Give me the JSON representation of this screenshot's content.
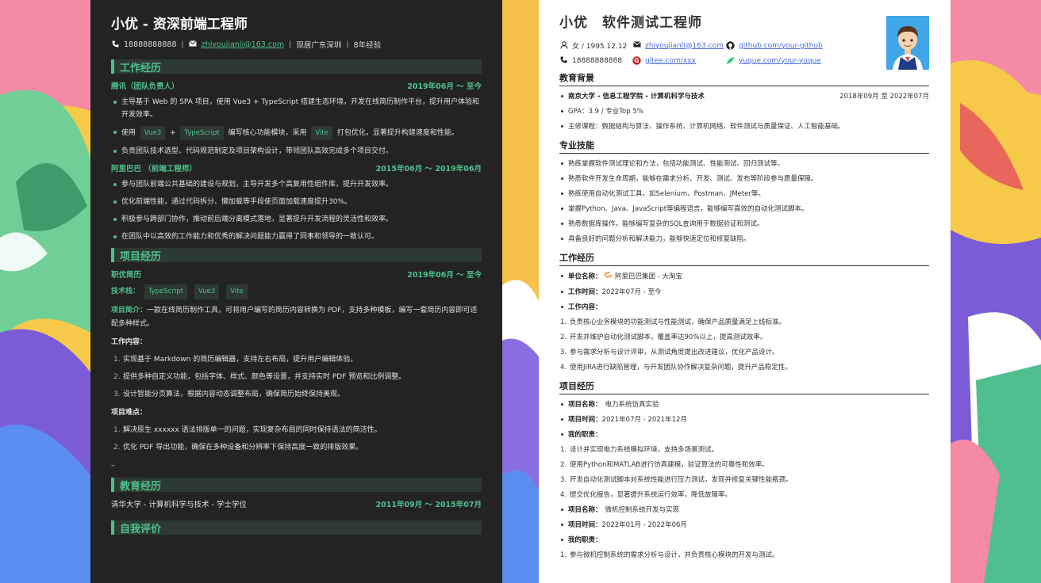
{
  "colors": {
    "accent": "#4fc08d",
    "dark_bg": "#232323",
    "link_blue": "#4a6bd8"
  },
  "dark_resume": {
    "name": "小优 - 资深前端工程师",
    "phone": "18888888888",
    "email": "zhiyoujianli@163.com",
    "location": "现居广东深圳",
    "experience_years": "8年经验",
    "sections": {
      "work": "工作经历",
      "projects": "项目经历",
      "education": "教育经历",
      "self_eval": "自我评价"
    },
    "jobs": [
      {
        "company": "腾讯（团队负责人）",
        "date": "2019年06月 ～ 至今",
        "items": [
          "主导基于 Web 的 SPA 项目，使用 Vue3 + TypeScript 搭建生态环境，开发在线简历制作平台，提升用户体验和开发效率。",
          "负责团队技术选型、代码规范制定及项目架构设计，带领团队高效完成多个项目交付。"
        ],
        "rich_item": {
          "pre": "使用",
          "tag1": "Vue3",
          "plus": "+",
          "tag2": "TypeScript",
          "mid": "编写核心功能模块，采用",
          "tag3": "Vite",
          "post": "打包优化，显著提升构建速度和性能。"
        }
      },
      {
        "company": "阿里巴巴 （前端工程师）",
        "date": "2015年06月 ～ 2019年06月",
        "items": [
          "参与团队前端公共基础的建设与规划，主导开发多个高复用性组件库，提升开发效率。",
          "优化前端性能，通过代码拆分、懒加载等手段使页面加载速度提升30%。",
          "积极参与跨部门协作，推动前后端分离模式落地，显著提升开发流程的灵活性和效率。",
          "在团队中以高效的工作能力和优秀的解决问题能力赢得了同事和领导的一致认可。"
        ]
      }
    ],
    "project": {
      "name": "职优简历",
      "date": "2019年06月 ～ 至今",
      "stack_label": "技术栈：",
      "stack": [
        "TypeScript",
        "Vue3",
        "Vite"
      ],
      "intro_label": "项目简介：",
      "intro": "一款在线简历制作工具，可将用户编写的简历内容转换为 PDF，支持多种模板，编写一套简历内容即可适配多种样式。",
      "content_label": "工作内容：",
      "content": [
        "实现基于 Markdown 的简历编辑器，支持左右布局，提升用户编辑体验。",
        "提供多种自定义功能，包括字体、样式、颜色等设置，并支持实时 PDF 预览和比例调整。",
        "设计智能分页算法，根据内容动态调整布局，确保简历始终保持美观。"
      ],
      "difficulty_label": "项目难点：",
      "difficulties": [
        "解决原生 xxxxxx 语法排版单一的问题，实现复杂布局的同时保持语法的简洁性。",
        "优化 PDF 导出功能，确保在多种设备和分辨率下保持高度一致的排版效果。"
      ],
      "dash": "–"
    },
    "education": {
      "school": "清华大学 - 计算机科学与技术 - 学士学位",
      "date": "2011年09月 ～ 2015年07月"
    }
  },
  "light_resume": {
    "name": "小优",
    "title": "软件测试工程师",
    "gender_birth": "女 / 1995.12.12",
    "email": "zhiyoujianli@163.com",
    "github": "github.com/your-github",
    "phone": "18888888888",
    "gitee": "gitee.com/xxx",
    "yuque": "yuque.com/your-yuque",
    "sections": {
      "education": "教育背景",
      "skills": "专业技能",
      "work": "工作经历",
      "projects": "项目经历"
    },
    "education": {
      "school": "南京大学 - 信息工程学院 - 计算机科学与技术",
      "date": "2018年09月 至 2022年07月",
      "gpa": "GPA：3.9 / 专业Top 5%",
      "courses": "主修课程：数据结构与算法、操作系统、计算机网络、软件测试与质量保证、人工智能基础。"
    },
    "skills": [
      "熟练掌握软件测试理论和方法，包括功能测试、性能测试、回归测试等。",
      "熟悉软件开发生命周期，能够在需求分析、开发、测试、发布等阶段参与质量保障。",
      "熟练使用自动化测试工具，如Selenium、Postman、JMeter等。",
      "掌握Python、Java、JavaScript等编程语言，能够编写高效的自动化测试脚本。",
      "熟悉数据库操作，能够编写复杂的SQL查询用于数据验证和测试。",
      "具备良好的问题分析和解决能力，能够快速定位和修复缺陷。"
    ],
    "work": {
      "unit_label": "单位名称",
      "unit": "阿里巴巴集团 - 大淘宝",
      "time_label": "工作时间",
      "time": "2022年07月 - 至今",
      "content_label": "工作内容",
      "items": [
        "负责核心业务模块的功能测试与性能测试，确保产品质量满足上线标准。",
        "开发并维护自动化测试脚本，覆盖率达90%以上，提高测试效率。",
        "参与需求分析与设计评审，从测试角度提出改进建议，优化产品设计。",
        "使用JIRA进行缺陷管理，与开发团队协作解决复杂问题，提升产品稳定性。"
      ]
    },
    "projects": [
      {
        "name_label": "项目名称",
        "name": "电力系统仿真实验",
        "time_label": "项目时间",
        "time": "2021年07月 - 2021年12月",
        "duty_label": "我的职责",
        "items": [
          "设计并实现电力系统模拟环境，支持多场景测试。",
          "使用Python和MATLAB进行仿真建模，验证算法的可靠性和效率。",
          "开发自动化测试脚本对系统性能进行压力测试，发现并修复关键性能瓶颈。",
          "提交优化报告，显著提升系统运行效率，降低故障率。"
        ]
      },
      {
        "name_label": "项目名称",
        "name": "微机控制系统开发与实现",
        "time_label": "项目时间",
        "time": "2022年01月 - 2022年06月",
        "duty_label": "我的职责",
        "items": [
          "参与微机控制系统的需求分析与设计，并负责核心模块的开发与测试。"
        ]
      }
    ]
  }
}
